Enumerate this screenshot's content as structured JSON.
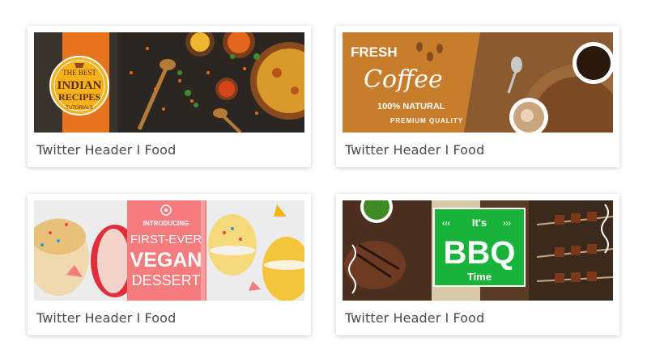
{
  "templates": [
    {
      "caption": "Twitter Header I Food",
      "banner": {
        "line1": "THE BEST",
        "line2": "INDIAN",
        "line3": "RECIPES",
        "line4": "TUTORIALS"
      },
      "colors": {
        "accent": "#e6731e",
        "badge": "#f5b21a",
        "bg": "#2a2520"
      }
    },
    {
      "caption": "Twitter Header I Food",
      "banner": {
        "line1": "FRESH",
        "line2": "Coffee",
        "line3": "100% NATURAL",
        "line4": "PREMIUM QUALITY"
      },
      "colors": {
        "accent": "#c77d2c",
        "bg": "#7a4a22"
      }
    },
    {
      "caption": "Twitter Header I Food",
      "banner": {
        "line1": "INTRODUCING",
        "line2": "FIRST-EVER",
        "line3": "VEGAN",
        "line4": "DESSERT"
      },
      "colors": {
        "accent": "#f47b7e",
        "bg": "#e9e9e9"
      }
    },
    {
      "caption": "Twitter Header I Food",
      "banner": {
        "line1": "It's",
        "line2": "BBQ",
        "line3": "Time"
      },
      "colors": {
        "accent": "#18b43a",
        "bg": "#5a3b26"
      }
    }
  ]
}
